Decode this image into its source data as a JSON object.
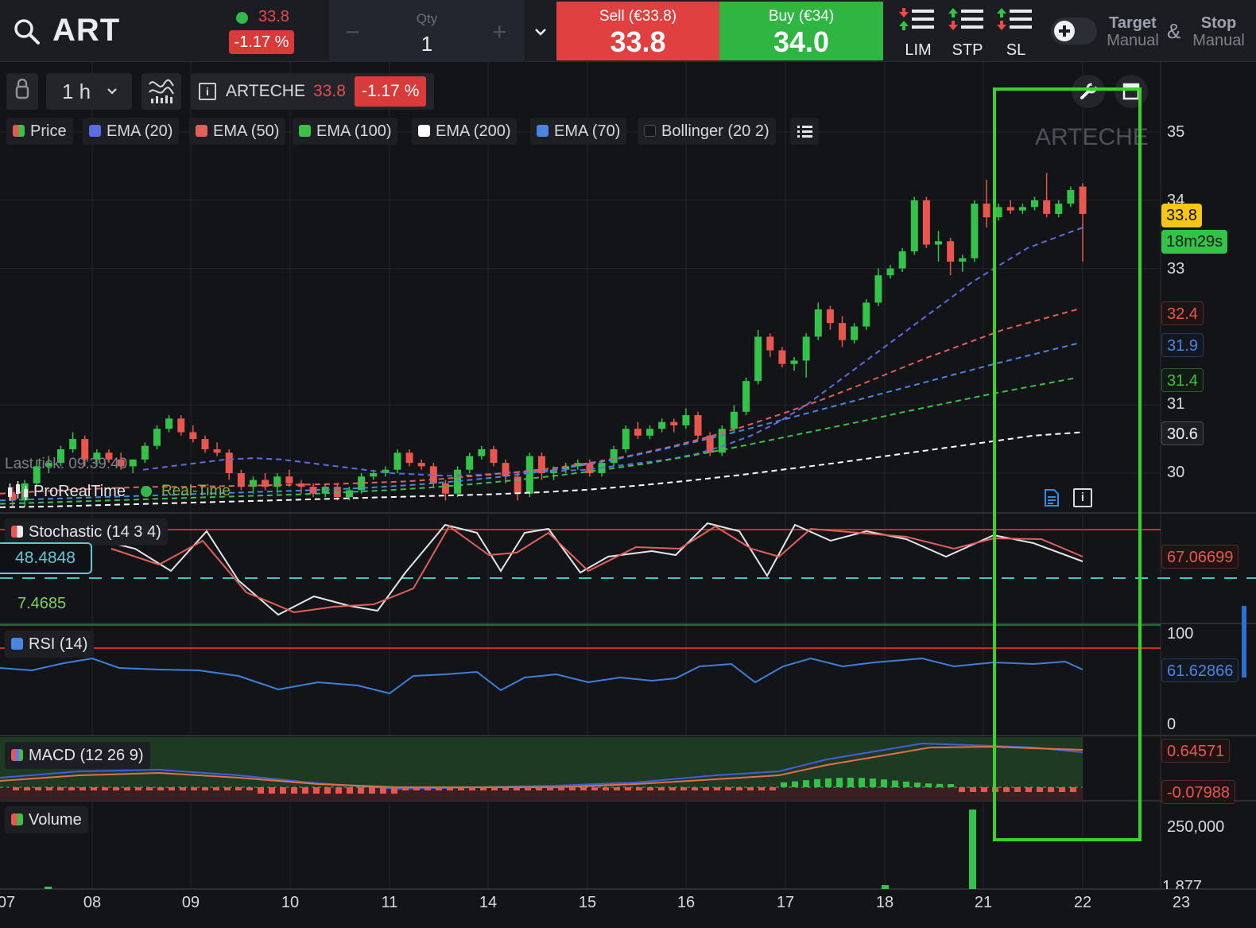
{
  "topbar": {
    "symbol": "ART",
    "price": "33.8",
    "change": "-1.17 %",
    "qty_label": "Qty",
    "qty_value": "1",
    "sell_label": "Sell (€33.8)",
    "sell_price": "33.8",
    "buy_label": "Buy (€34)",
    "buy_price": "34.0",
    "order_types": [
      "LIM",
      "STP",
      "SL"
    ],
    "target_label": "Target",
    "target_mode": "Manual",
    "amp": "&",
    "stop_label": "Stop",
    "stop_mode": "Manual"
  },
  "toolbar": {
    "interval": "1 h",
    "instrument_name": "ARTECHE",
    "instrument_price": "33.8",
    "instrument_change": "-1.17 %"
  },
  "legend": [
    {
      "label": "Price",
      "color": "#e8574f"
    },
    {
      "label": "EMA (20)",
      "color": "#5b6ee1"
    },
    {
      "label": "EMA (50)",
      "color": "#e0605a"
    },
    {
      "label": "EMA (100)",
      "color": "#3cc04a"
    },
    {
      "label": "EMA (200)",
      "color": "#ffffff"
    },
    {
      "label": "EMA (70)",
      "color": "#4a86e0"
    },
    {
      "label": "Bollinger (20 2)",
      "color": "#1d1f24"
    }
  ],
  "watermark": "ARTECHE",
  "price_panel": {
    "last_tick": "Last tick: 09:39:40",
    "source": "ProRealTime",
    "feed": "Real-Time",
    "axis_ticks": [
      {
        "label": "35",
        "value": 35
      },
      {
        "label": "34",
        "value": 34
      },
      {
        "label": "33",
        "value": 33
      },
      {
        "label": "31",
        "value": 31
      },
      {
        "label": "30",
        "value": 30
      }
    ],
    "tags": {
      "last": "33.8",
      "countdown": "18m29s",
      "ema50": "32.4",
      "ema70": "31.9",
      "ema100": "31.4",
      "ema200": "30.6"
    }
  },
  "stochastic": {
    "title": "Stochastic (14 3 4)",
    "value": "48.4848",
    "low": "7.4685",
    "axis_value": "67.06699"
  },
  "rsi": {
    "title": "RSI (14)",
    "axis_top": "100",
    "axis_bottom": "0",
    "value": "61.62866"
  },
  "macd": {
    "title": "MACD (12 26 9)",
    "value": "0.64571",
    "histogram": "-0.07988"
  },
  "volume": {
    "title": "Volume",
    "axis_top": "250,000",
    "axis_bottom": "1,877"
  },
  "x_axis": [
    "07",
    "08",
    "09",
    "10",
    "11",
    "14",
    "15",
    "16",
    "17",
    "18",
    "21",
    "22",
    "23"
  ],
  "chart_data": {
    "type": "candlestick",
    "interval": "1 h",
    "x_labels": [
      "07",
      "08",
      "09",
      "10",
      "11",
      "14",
      "15",
      "16",
      "17",
      "18",
      "21",
      "22",
      "23"
    ],
    "y_axis_ticks": [
      30,
      31,
      33,
      34,
      35
    ],
    "last_price": 33.8,
    "candles_ohlc": [
      [
        29.7,
        29.8,
        29.5,
        29.6
      ],
      [
        29.6,
        29.9,
        29.5,
        29.85
      ],
      [
        29.85,
        30.2,
        29.8,
        30.1
      ],
      [
        30.1,
        30.25,
        30.0,
        30.15
      ],
      [
        30.15,
        30.4,
        30.1,
        30.35
      ],
      [
        30.35,
        30.6,
        30.3,
        30.5
      ],
      [
        30.5,
        30.55,
        30.1,
        30.2
      ],
      [
        30.2,
        30.35,
        30.1,
        30.3
      ],
      [
        30.3,
        30.35,
        30.15,
        30.2
      ],
      [
        30.2,
        30.3,
        30.05,
        30.1
      ],
      [
        30.1,
        30.2,
        30.0,
        30.2
      ],
      [
        30.2,
        30.45,
        30.15,
        30.4
      ],
      [
        30.4,
        30.7,
        30.35,
        30.65
      ],
      [
        30.65,
        30.85,
        30.6,
        30.8
      ],
      [
        30.8,
        30.85,
        30.55,
        30.6
      ],
      [
        30.6,
        30.7,
        30.45,
        30.5
      ],
      [
        30.5,
        30.55,
        30.3,
        30.35
      ],
      [
        30.35,
        30.45,
        30.25,
        30.3
      ],
      [
        30.3,
        30.35,
        29.9,
        30.0
      ],
      [
        30.0,
        30.05,
        29.75,
        29.8
      ],
      [
        29.8,
        29.95,
        29.7,
        29.9
      ],
      [
        29.9,
        30.0,
        29.75,
        29.8
      ],
      [
        29.8,
        30.0,
        29.7,
        29.95
      ],
      [
        29.95,
        30.05,
        29.8,
        29.85
      ],
      [
        29.85,
        29.9,
        29.7,
        29.8
      ],
      [
        29.8,
        29.85,
        29.65,
        29.7
      ],
      [
        29.7,
        29.85,
        29.65,
        29.8
      ],
      [
        29.8,
        29.85,
        29.6,
        29.65
      ],
      [
        29.65,
        29.8,
        29.6,
        29.75
      ],
      [
        29.75,
        30.0,
        29.7,
        29.95
      ],
      [
        29.95,
        30.05,
        29.9,
        30.0
      ],
      [
        30.0,
        30.1,
        29.95,
        30.05
      ],
      [
        30.05,
        30.35,
        30.0,
        30.3
      ],
      [
        30.3,
        30.35,
        30.1,
        30.15
      ],
      [
        30.15,
        30.2,
        30.05,
        30.1
      ],
      [
        30.1,
        30.15,
        29.8,
        29.85
      ],
      [
        29.85,
        29.9,
        29.6,
        29.7
      ],
      [
        29.7,
        30.1,
        29.65,
        30.05
      ],
      [
        30.05,
        30.3,
        30.0,
        30.25
      ],
      [
        30.25,
        30.4,
        30.2,
        30.35
      ],
      [
        30.35,
        30.4,
        30.1,
        30.15
      ],
      [
        30.15,
        30.2,
        29.85,
        29.95
      ],
      [
        29.95,
        30.0,
        29.6,
        29.7
      ],
      [
        29.7,
        30.3,
        29.65,
        30.25
      ],
      [
        30.25,
        30.3,
        29.9,
        30.0
      ],
      [
        30.0,
        30.1,
        29.9,
        30.05
      ],
      [
        30.05,
        30.15,
        30.0,
        30.1
      ],
      [
        30.1,
        30.2,
        30.05,
        30.15
      ],
      [
        30.15,
        30.2,
        29.95,
        30.0
      ],
      [
        30.0,
        30.2,
        29.95,
        30.15
      ],
      [
        30.15,
        30.4,
        30.1,
        30.35
      ],
      [
        30.35,
        30.7,
        30.3,
        30.65
      ],
      [
        30.65,
        30.75,
        30.5,
        30.55
      ],
      [
        30.55,
        30.7,
        30.5,
        30.65
      ],
      [
        30.65,
        30.8,
        30.6,
        30.75
      ],
      [
        30.75,
        30.8,
        30.6,
        30.7
      ],
      [
        30.7,
        30.95,
        30.65,
        30.85
      ],
      [
        30.85,
        30.9,
        30.5,
        30.55
      ],
      [
        30.55,
        30.6,
        30.25,
        30.3
      ],
      [
        30.3,
        30.7,
        30.25,
        30.65
      ],
      [
        30.65,
        31.0,
        30.6,
        30.9
      ],
      [
        30.9,
        31.4,
        30.85,
        31.35
      ],
      [
        31.35,
        32.1,
        31.3,
        32.0
      ],
      [
        32.0,
        32.05,
        31.7,
        31.8
      ],
      [
        31.8,
        31.85,
        31.55,
        31.6
      ],
      [
        31.6,
        31.7,
        31.5,
        31.65
      ],
      [
        31.65,
        32.05,
        31.4,
        32.0
      ],
      [
        32.0,
        32.5,
        31.95,
        32.4
      ],
      [
        32.4,
        32.45,
        32.1,
        32.2
      ],
      [
        32.2,
        32.3,
        31.85,
        31.95
      ],
      [
        31.95,
        32.2,
        31.9,
        32.15
      ],
      [
        32.15,
        32.55,
        32.1,
        32.5
      ],
      [
        32.5,
        33.0,
        32.45,
        32.9
      ],
      [
        32.9,
        33.05,
        32.85,
        33.0
      ],
      [
        33.0,
        33.3,
        32.95,
        33.25
      ],
      [
        33.25,
        34.05,
        33.2,
        34.0
      ],
      [
        34.0,
        34.05,
        33.3,
        33.35
      ],
      [
        33.35,
        33.55,
        33.1,
        33.4
      ],
      [
        33.4,
        33.45,
        32.9,
        33.1
      ],
      [
        33.1,
        33.2,
        32.95,
        33.15
      ],
      [
        33.15,
        34.0,
        33.1,
        33.95
      ],
      [
        33.95,
        34.3,
        33.6,
        33.75
      ],
      [
        33.75,
        33.95,
        33.7,
        33.9
      ],
      [
        33.9,
        34.0,
        33.8,
        33.85
      ],
      [
        33.85,
        33.95,
        33.8,
        33.9
      ],
      [
        33.9,
        34.05,
        33.85,
        34.0
      ],
      [
        34.0,
        34.4,
        33.75,
        33.8
      ],
      [
        33.8,
        34.0,
        33.75,
        33.95
      ],
      [
        33.95,
        34.2,
        33.9,
        34.15
      ],
      [
        34.2,
        34.25,
        33.1,
        33.8
      ]
    ],
    "series": [
      {
        "name": "EMA (20)",
        "color": "#5b6ee1",
        "values": [
          30.05,
          30.1,
          30.15,
          30.2,
          30.22,
          30.2,
          30.15,
          30.1,
          30.05,
          30.0,
          29.98,
          29.96,
          29.97,
          30.0,
          30.02,
          30.03,
          30.05,
          30.1,
          30.15,
          30.2,
          30.28,
          30.4,
          30.55,
          30.75,
          31.0,
          31.3,
          31.6,
          31.9,
          32.2,
          32.5,
          32.8,
          33.05,
          33.3,
          33.45,
          33.6
        ]
      },
      {
        "name": "EMA (50)",
        "color": "#e0605a",
        "values": [
          29.7,
          29.73,
          29.76,
          29.78,
          29.8,
          29.8,
          29.81,
          29.82,
          29.83,
          29.84,
          29.86,
          29.88,
          29.92,
          29.97,
          30.02,
          30.08,
          30.16,
          30.26,
          30.38,
          30.52,
          30.68,
          30.86,
          31.05,
          31.26,
          31.48,
          31.7,
          31.9,
          32.1,
          32.25,
          32.4
        ]
      },
      {
        "name": "EMA (70)",
        "color": "#4a86e0",
        "values": [
          29.6,
          29.62,
          29.64,
          29.66,
          29.68,
          29.7,
          29.72,
          29.74,
          29.76,
          29.79,
          29.83,
          29.88,
          29.94,
          30.02,
          30.11,
          30.22,
          30.35,
          30.49,
          30.64,
          30.8,
          30.96,
          31.12,
          31.28,
          31.44,
          31.6,
          31.75,
          31.9
        ]
      },
      {
        "name": "EMA (100)",
        "color": "#3cc04a",
        "values": [
          29.55,
          29.57,
          29.59,
          29.61,
          29.63,
          29.65,
          29.67,
          29.69,
          29.72,
          29.75,
          29.79,
          29.84,
          29.9,
          29.97,
          30.05,
          30.14,
          30.25,
          30.37,
          30.5,
          30.63,
          30.76,
          30.9,
          31.03,
          31.16,
          31.28,
          31.4
        ]
      },
      {
        "name": "EMA (200)",
        "color": "#ffffff",
        "values": [
          29.5,
          29.51,
          29.53,
          29.55,
          29.57,
          29.59,
          29.61,
          29.63,
          29.65,
          29.67,
          29.69,
          29.72,
          29.76,
          29.82,
          29.89,
          29.97,
          30.06,
          30.15,
          30.25,
          30.35,
          30.45,
          30.55,
          30.6
        ]
      }
    ]
  }
}
